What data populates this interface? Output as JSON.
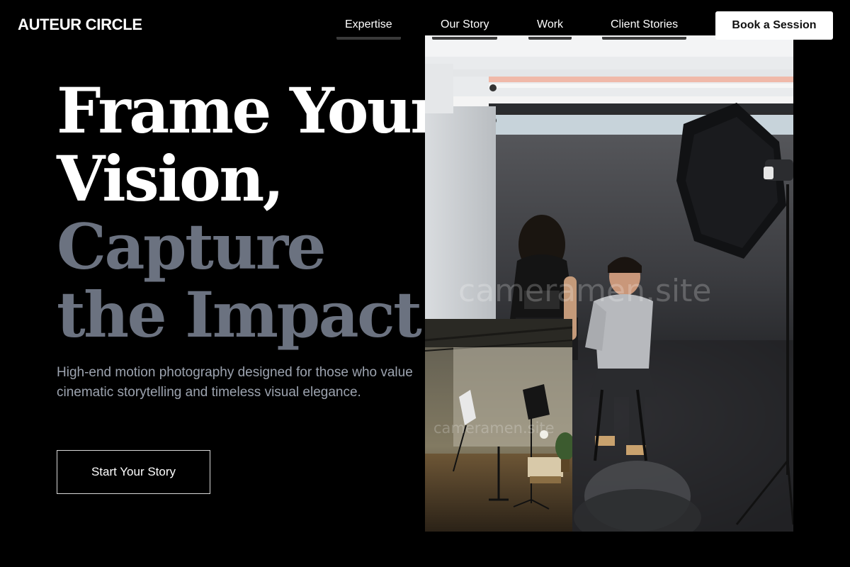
{
  "brand": {
    "logo": "AUTEUR CIRCLE"
  },
  "nav": {
    "items": [
      {
        "label": "Expertise"
      },
      {
        "label": "Our Story"
      },
      {
        "label": "Work"
      },
      {
        "label": "Client Stories"
      }
    ],
    "cta_label": "Book a Session"
  },
  "hero": {
    "headline_line1": "Frame Your",
    "headline_line2": "Vision,",
    "headline_line3": "Capture",
    "headline_line4": "the Impact.",
    "subtitle": "High-end motion photography designed for those who value cinematic storytelling and timeless visual elegance.",
    "cta_label": "Start Your Story"
  },
  "media": {
    "main_watermark": "cameramen.site",
    "inset_watermark": "cameramen.site"
  },
  "colors": {
    "background": "#000000",
    "text_primary": "#ffffff",
    "text_muted": "#6b7280",
    "text_subtle": "#9ca3af",
    "button_light_bg": "#ffffff",
    "button_light_text": "#111111"
  }
}
